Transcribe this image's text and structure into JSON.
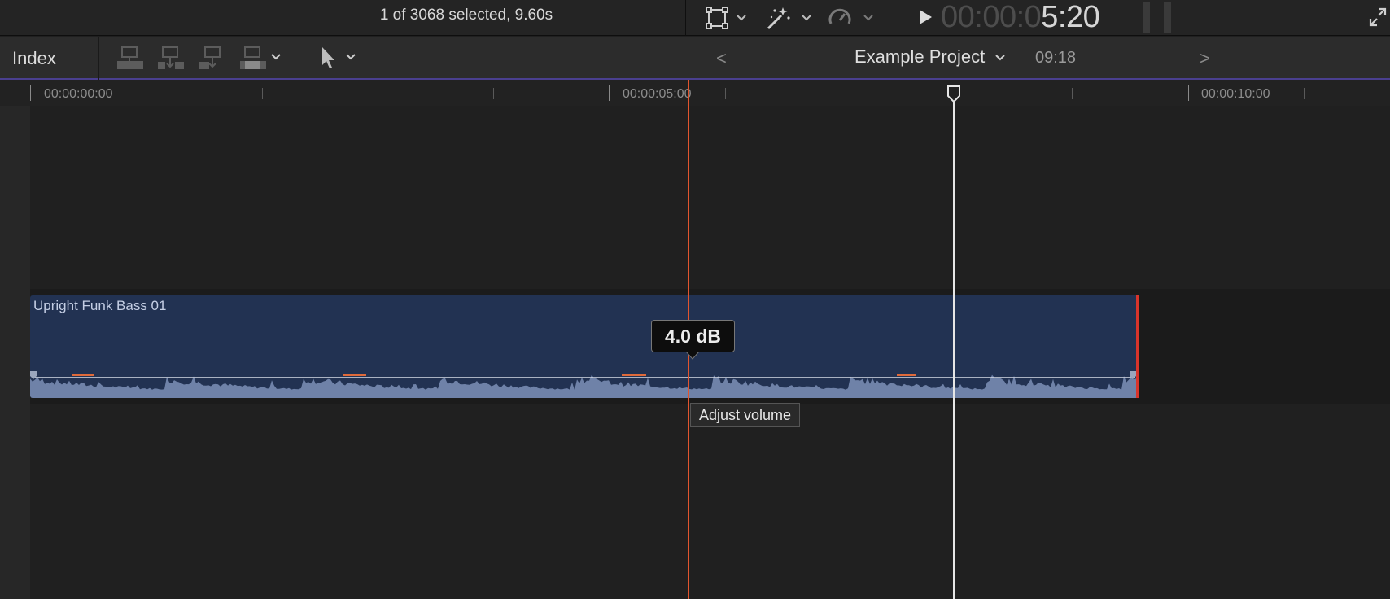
{
  "topbar": {
    "selection_text": "1 of 3068 selected, 9.60s",
    "timecode_dim": "00:00:0",
    "timecode_bright": "5:20",
    "icons": [
      "transform-icon",
      "magic-wand-icon",
      "speed-icon",
      "play-icon",
      "fullscreen-icon"
    ]
  },
  "toolbar": {
    "index_label": "Index",
    "project_name": "Example Project",
    "project_duration": "09:18",
    "prev_arrow": "<",
    "next_arrow": ">"
  },
  "ruler": {
    "labels": [
      "00:00:00:00",
      "00:00:05:00",
      "00:00:10:00"
    ]
  },
  "clip": {
    "title": "Upright Funk Bass 01",
    "volume_readout": "4.0 dB",
    "tooltip": "Adjust volume"
  },
  "colors": {
    "accent_purple": "#4a3f8f",
    "clip_blue": "#223252",
    "skim_orange": "#e2552e",
    "clip_end_red": "#d9342b"
  }
}
